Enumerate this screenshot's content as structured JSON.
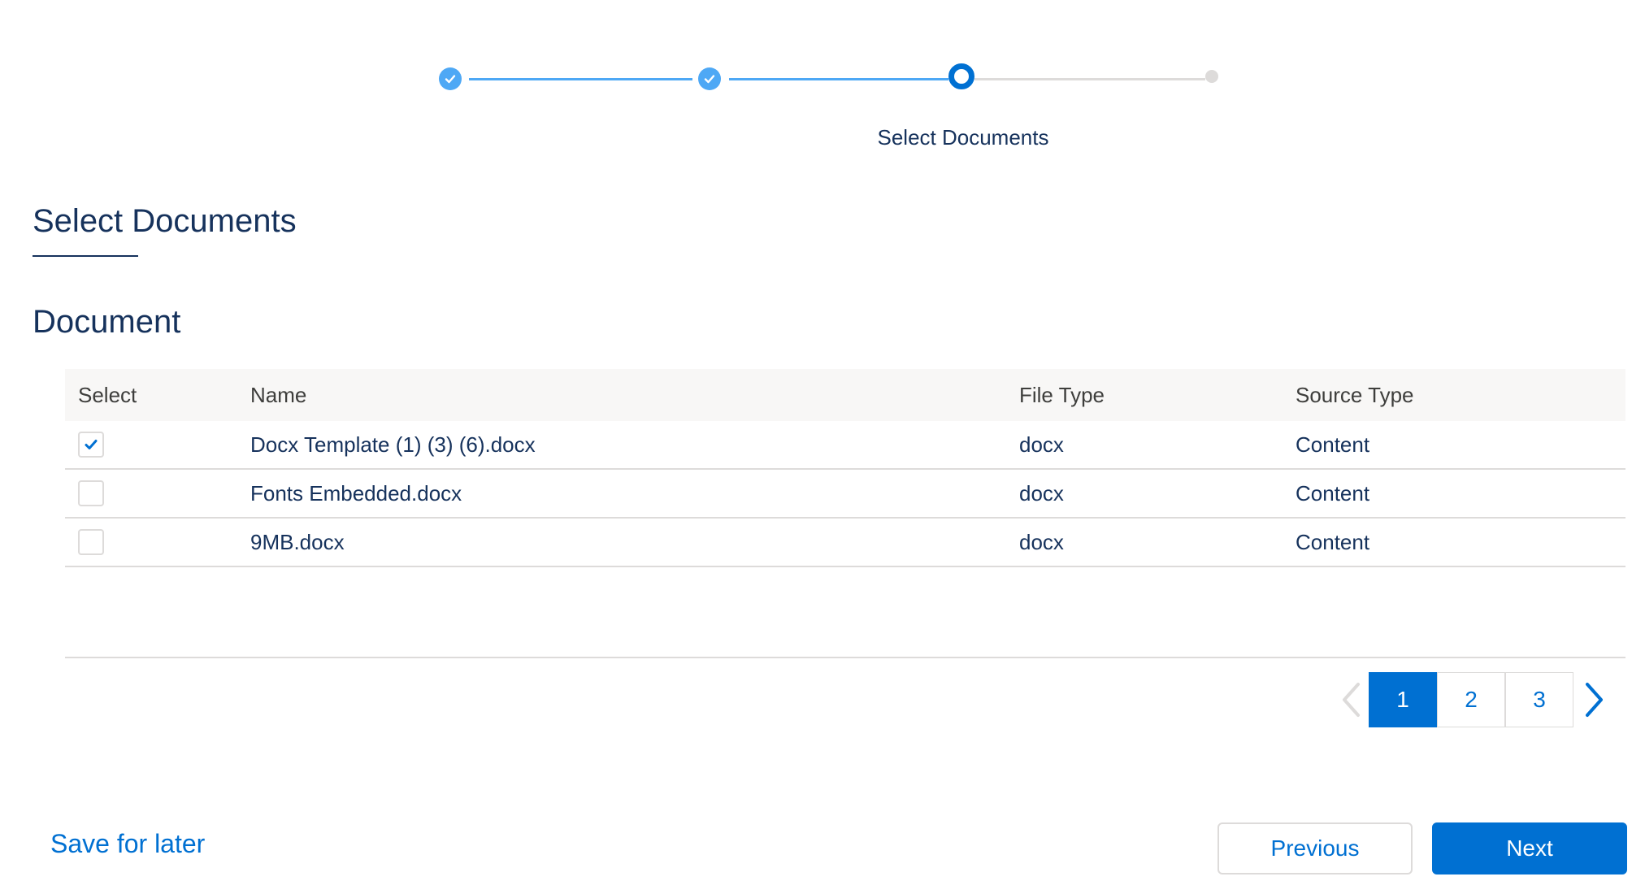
{
  "progress": {
    "current_step_label": "Select Documents"
  },
  "page_title": "Select Documents",
  "section_title": "Document",
  "table": {
    "headers": [
      "Select",
      "Name",
      "File Type",
      "Source Type"
    ],
    "rows": [
      {
        "selected": true,
        "name": "Docx Template (1) (3) (6).docx",
        "file_type": "docx",
        "source_type": "Content"
      },
      {
        "selected": false,
        "name": "Fonts Embedded.docx",
        "file_type": "docx",
        "source_type": "Content"
      },
      {
        "selected": false,
        "name": "9MB.docx",
        "file_type": "docx",
        "source_type": "Content"
      }
    ]
  },
  "pagination": {
    "pages": [
      "1",
      "2",
      "3"
    ],
    "current": "1"
  },
  "footer": {
    "save_label": "Save for later",
    "previous_label": "Previous",
    "next_label": "Next"
  },
  "colors": {
    "brand": "#0070d2",
    "completed_step": "#4ea8f5",
    "text": "#16325c"
  }
}
